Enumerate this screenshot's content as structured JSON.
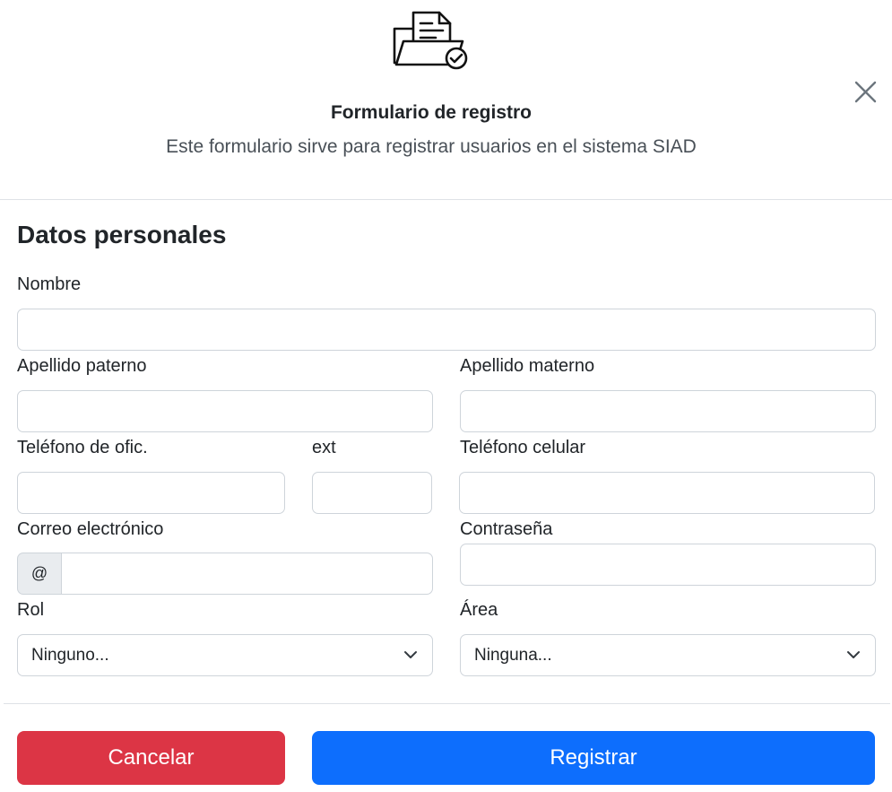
{
  "header": {
    "icon": "folder-document-check-icon",
    "title": "Formulario de registro",
    "subtitle": "Este formulario sirve para registrar usuarios en el sistema SIAD",
    "close_icon": "close-icon"
  },
  "form": {
    "section_title": "Datos personales",
    "nombre": {
      "label": "Nombre",
      "value": ""
    },
    "apellido_paterno": {
      "label": "Apellido paterno",
      "value": ""
    },
    "apellido_materno": {
      "label": "Apellido materno",
      "value": ""
    },
    "telefono_oficina": {
      "label": "Teléfono de ofic.",
      "value": ""
    },
    "ext": {
      "label": "ext",
      "value": ""
    },
    "telefono_celular": {
      "label": "Teléfono celular",
      "value": ""
    },
    "correo": {
      "label": "Correo electrónico",
      "addon": "@",
      "value": ""
    },
    "contrasena": {
      "label": "Contraseña",
      "value": ""
    },
    "rol": {
      "label": "Rol",
      "selected": "Ninguno..."
    },
    "area": {
      "label": "Área",
      "selected": "Ninguna..."
    }
  },
  "actions": {
    "cancel_label": "Cancelar",
    "register_label": "Registrar"
  },
  "colors": {
    "cancel": "#dc3545",
    "register": "#0d6efd",
    "border": "#ced4da",
    "addon_bg": "#e9ecef"
  }
}
